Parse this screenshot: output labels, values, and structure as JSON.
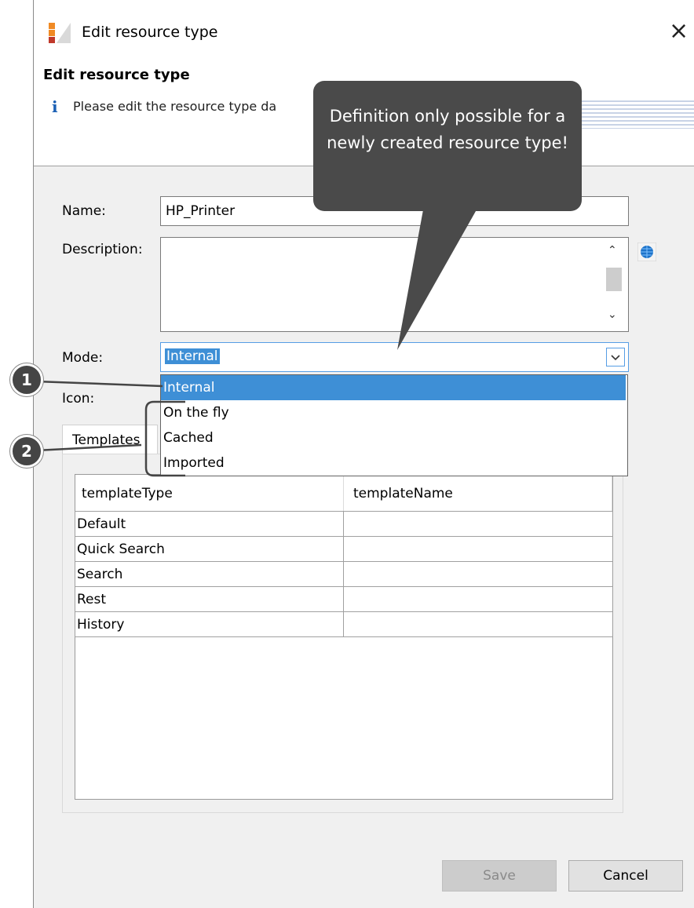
{
  "window": {
    "title": "Edit resource type",
    "close_glyph": "×"
  },
  "header": {
    "title": "Edit resource type",
    "info_text": "Please edit the resource type da"
  },
  "form": {
    "name_label": "Name:",
    "name_value": "HP_Printer",
    "description_label": "Description:",
    "description_value": "",
    "mode_label": "Mode:",
    "mode_value": "Internal",
    "icon_label": "Icon:"
  },
  "mode_dropdown": {
    "options": [
      "Internal",
      "On the fly",
      "Cached",
      "Imported"
    ],
    "selected_index": 0
  },
  "tabs": {
    "templates_label": "Templates"
  },
  "templates_table": {
    "columns": [
      "templateType",
      "templateName"
    ],
    "rows": [
      [
        "Default",
        ""
      ],
      [
        "Quick Search",
        ""
      ],
      [
        "Search",
        ""
      ],
      [
        "Rest",
        ""
      ],
      [
        "History",
        ""
      ]
    ]
  },
  "buttons": {
    "save_label": "Save",
    "cancel_label": "Cancel",
    "save_enabled": false
  },
  "annotations": {
    "callout_text": "Definition only possible for a newly created resource type!",
    "marker_1": "1",
    "marker_2": "2"
  },
  "colors": {
    "selection": "#3e8fd6",
    "callout": "#4a4a4a",
    "marker": "#454545"
  }
}
